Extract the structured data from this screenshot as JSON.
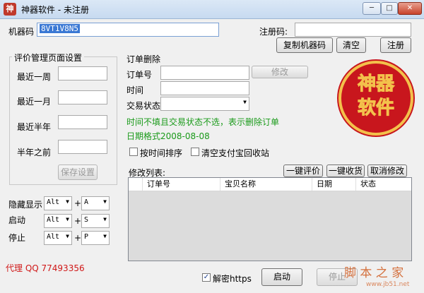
{
  "window": {
    "title": "神器软件 - 未注册",
    "logo_char": "神",
    "controls": [
      "─",
      "□",
      "✕"
    ]
  },
  "machine": {
    "label": "机器码",
    "value": "8VT1V8N5"
  },
  "register": {
    "label": "注册码:",
    "value": ""
  },
  "buttons": {
    "copy_machine": "复制机器码",
    "clear": "清空",
    "register": "注册"
  },
  "review": {
    "title": "评价管理页面设置",
    "rows": [
      "最近一周",
      "最近一月",
      "最近半年",
      "半年之前"
    ],
    "save": "保存设置"
  },
  "hotkeys": {
    "rows": [
      {
        "label": "隐藏显示",
        "mod": "Alt",
        "key": "A"
      },
      {
        "label": "启动",
        "mod": "Alt",
        "key": "S"
      },
      {
        "label": "停止",
        "mod": "Alt",
        "key": "P"
      }
    ],
    "plus": "+"
  },
  "agent": "代理 QQ 77493356",
  "order_delete": {
    "title": "订单删除",
    "order_label": "订单号",
    "time_label": "时间",
    "status_label": "交易状态",
    "modify": "修改",
    "note": "时间不填且交易状态不选，表示删除订单",
    "date_format": "日期格式2008-08-08"
  },
  "logo": {
    "line1": "神器",
    "line2": "软件"
  },
  "options": {
    "sort_by_time": "按时间排序",
    "clear_recycle": "清空支付宝回收站"
  },
  "modify_list": {
    "label": "修改列表:",
    "one_key_review": "一键评价",
    "one_key_receive": "一键收货",
    "cancel_modify": "取消修改",
    "columns": [
      "订单号",
      "宝贝名称",
      "日期",
      "状态"
    ]
  },
  "bottom": {
    "decrypt_https": "解密https",
    "start": "启动",
    "stop": "停止"
  },
  "watermark": {
    "line1": "脚 本 之 家",
    "line2": "www.jb51.net"
  },
  "colors": {
    "logo_red": "#c8161d",
    "logo_gold": "#f3c14b",
    "note_green": "#1a9a1a",
    "agent_red": "#d01818"
  }
}
